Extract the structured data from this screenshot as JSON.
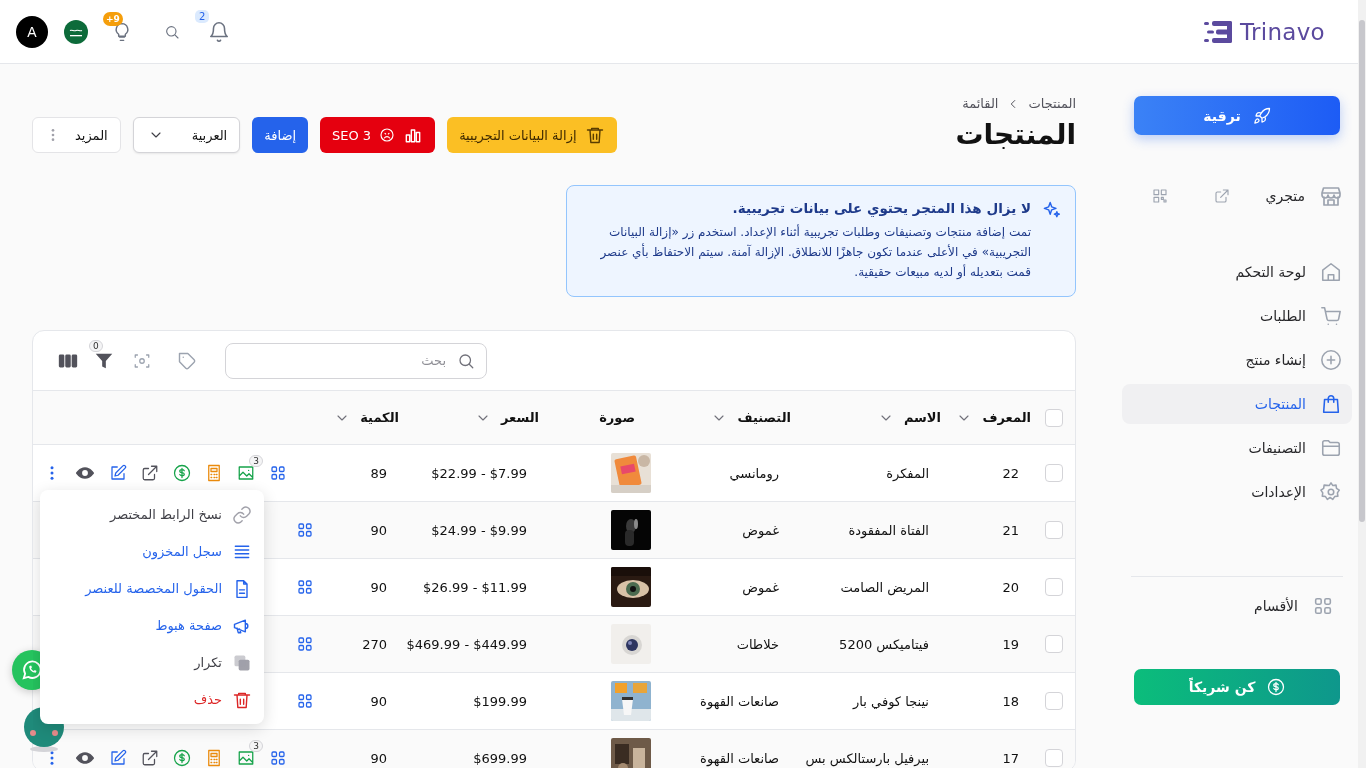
{
  "topbar": {
    "logo": "Trinavo",
    "avatar_letter": "A",
    "tips_badge": "+9",
    "notifications_badge": "2"
  },
  "sidebar": {
    "upgrade": "ترقية",
    "store": "متجري",
    "nav": [
      {
        "label": "لوحة التحكم",
        "kind": "home",
        "selected": false
      },
      {
        "label": "الطلبات",
        "kind": "cart",
        "selected": false
      },
      {
        "label": "إنشاء منتج",
        "kind": "plus",
        "selected": false
      },
      {
        "label": "المنتجات",
        "kind": "bag",
        "selected": true
      },
      {
        "label": "التصنيفات",
        "kind": "folder",
        "selected": false
      },
      {
        "label": "الإعدادات",
        "kind": "gear",
        "selected": false
      }
    ],
    "sections": "الأقسام",
    "partner": "كن شريكاً"
  },
  "breadcrumb": [
    "المنتجات",
    "القائمة"
  ],
  "title": "المنتجات",
  "actions": [
    {
      "kind": "remove-demo",
      "label": "إزالة البيانات التجريبية"
    },
    {
      "kind": "seo",
      "label": "SEO 3"
    },
    {
      "kind": "add",
      "label": "إضافة"
    },
    {
      "kind": "language",
      "label": "العربية"
    },
    {
      "kind": "more",
      "label": "المزيد"
    }
  ],
  "notice": {
    "title": "لا يزال هذا المتجر يحتوي على بيانات تجريبية.",
    "text": "تمت إضافة منتجات وتصنيفات وطلبات تجريبية أثناء الإعداد. استخدم زر «إزالة البيانات التجريبية» في الأعلى عندما تكون جاهزًا للانطلاق. الإزالة آمنة. سيتم الاحتفاظ بأي عنصر قمت بتعديله أو لديه مبيعات حقيقية."
  },
  "table": {
    "search": {
      "placeholder": "بحث"
    },
    "filter_count": "0",
    "all_checked": false,
    "columns": [
      {
        "label": "المعرف",
        "sortable": true
      },
      {
        "label": "الاسم",
        "sortable": true
      },
      {
        "label": "التصنيف",
        "sortable": true
      },
      {
        "label": "صورة",
        "sortable": false
      },
      {
        "label": "السعر",
        "sortable": true
      },
      {
        "label": "الكمية",
        "sortable": true
      }
    ],
    "rows": [
      {
        "id": "22",
        "name": "المفكرة",
        "category": "رومانسي",
        "price": "$22.99 - $7.99",
        "quantity": "89",
        "checked": false,
        "image_count": "3",
        "covered": false
      },
      {
        "id": "21",
        "name": "الفتاة المفقودة",
        "category": "غموض",
        "price": "$24.99 - $9.99",
        "quantity": "90",
        "checked": false,
        "covered": true
      },
      {
        "id": "20",
        "name": "المريض الصامت",
        "category": "غموض",
        "price": "$26.99 - $11.99",
        "quantity": "90",
        "checked": false,
        "covered": true
      },
      {
        "id": "19",
        "name": "فيتاميكس 5200",
        "category": "خلاطات",
        "price": "$469.99 - $449.99",
        "quantity": "270",
        "checked": false,
        "covered": true
      },
      {
        "id": "18",
        "name": "نينجا كوفي بار",
        "category": "صانعات القهوة",
        "price": "$199.99",
        "quantity": "90",
        "checked": false,
        "covered": true
      },
      {
        "id": "17",
        "name": "بيرفيل بارستالكس بس",
        "category": "صانعات القهوة",
        "price": "$699.99",
        "quantity": "90",
        "checked": false,
        "image_count": "3",
        "covered": false
      }
    ],
    "menu": [
      {
        "kind": "link",
        "label": "نسخ الرابط المختصر",
        "color": "#3f3f46"
      },
      {
        "kind": "list",
        "label": "سجل المخزون",
        "color": "#2563eb"
      },
      {
        "kind": "doc",
        "label": "الحقول المخصصة للعنصر",
        "color": "#2563eb"
      },
      {
        "kind": "megaphone",
        "label": "صفحة هبوط",
        "color": "#2563eb"
      },
      {
        "kind": "copy",
        "label": "تكرار",
        "color": "#3f3f46"
      },
      {
        "kind": "trash",
        "label": "حذف",
        "color": "#dc2626"
      }
    ]
  }
}
